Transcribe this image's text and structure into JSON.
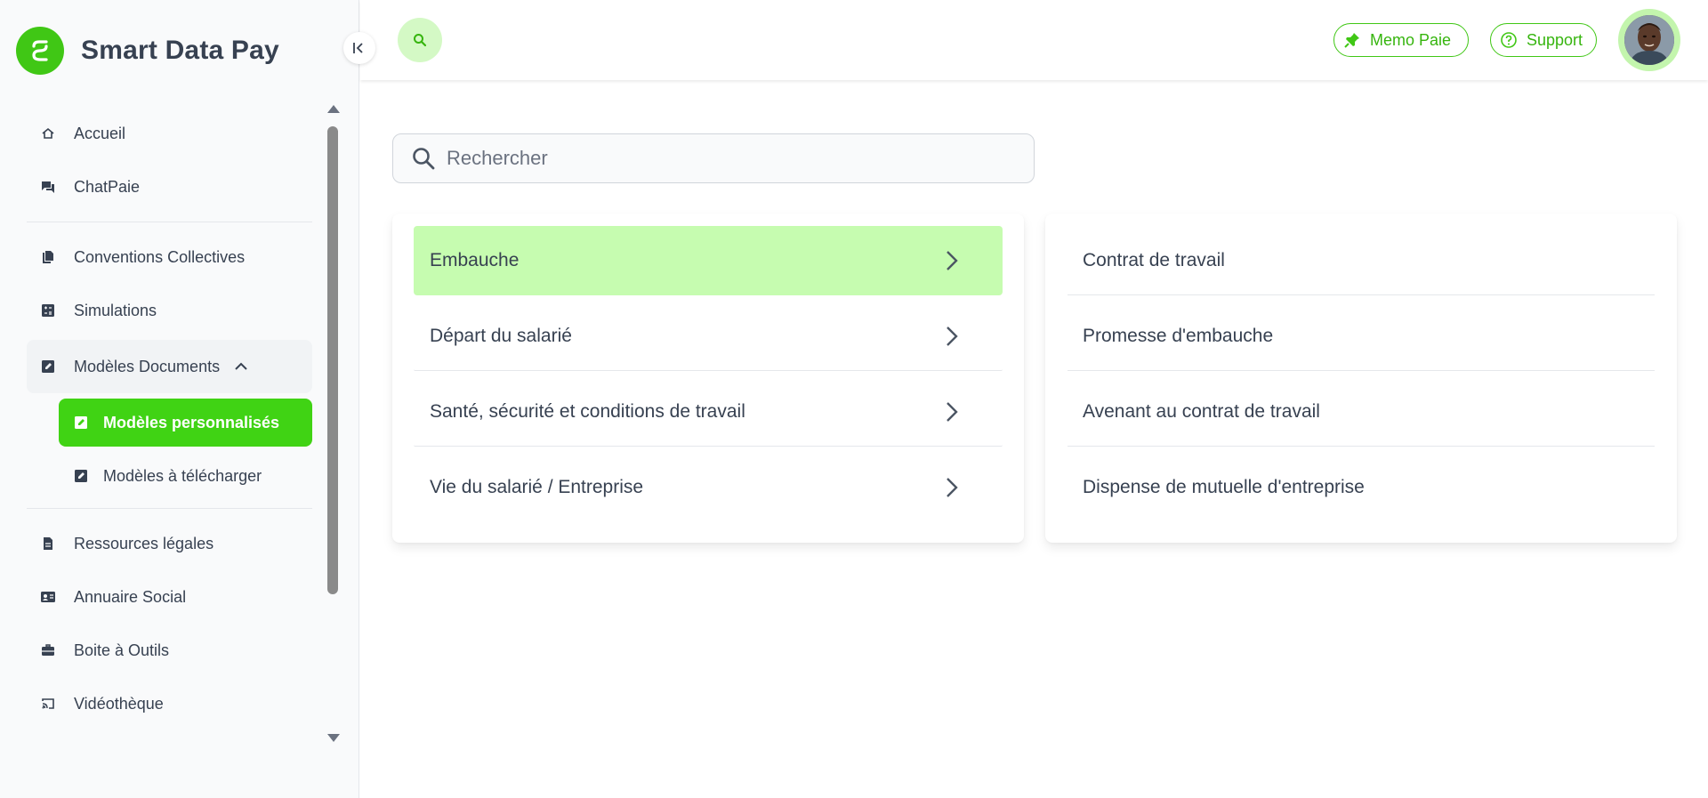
{
  "brand": {
    "name": "Smart Data Pay",
    "icon": "brand-s-logo"
  },
  "colors": {
    "accent": "#40c715",
    "active": "#40d314",
    "highlight": "#c6fcb0",
    "text": "#374151"
  },
  "sidebar": {
    "items": [
      {
        "label": "Accueil",
        "icon": "home-icon"
      },
      {
        "label": "ChatPaie",
        "icon": "chat-icon"
      },
      {
        "label": "Conventions Collectives",
        "icon": "copy-icon"
      },
      {
        "label": "Simulations",
        "icon": "calculator-icon"
      },
      {
        "label": "Modèles Documents",
        "icon": "edit-doc-icon",
        "expanded": true,
        "children": [
          {
            "label": "Modèles personnalisés",
            "active": true
          },
          {
            "label": "Modèles à télécharger"
          }
        ]
      },
      {
        "label": "Ressources légales",
        "icon": "document-icon"
      },
      {
        "label": "Annuaire Social",
        "icon": "contact-card-icon"
      },
      {
        "label": "Boite à Outils",
        "icon": "toolbox-icon"
      },
      {
        "label": "Vidéothèque",
        "icon": "cast-icon"
      }
    ]
  },
  "header": {
    "memo_label": "Memo Paie",
    "support_label": "Support"
  },
  "search": {
    "placeholder": "Rechercher"
  },
  "categories": [
    {
      "label": "Embauche",
      "active": true
    },
    {
      "label": "Départ du salarié"
    },
    {
      "label": "Santé, sécurité et conditions de travail"
    },
    {
      "label": "Vie du salarié / Entreprise"
    }
  ],
  "documents": [
    {
      "label": "Contrat de travail"
    },
    {
      "label": "Promesse d'embauche"
    },
    {
      "label": "Avenant au contrat de travail"
    },
    {
      "label": "Dispense de mutuelle d'entreprise"
    }
  ]
}
